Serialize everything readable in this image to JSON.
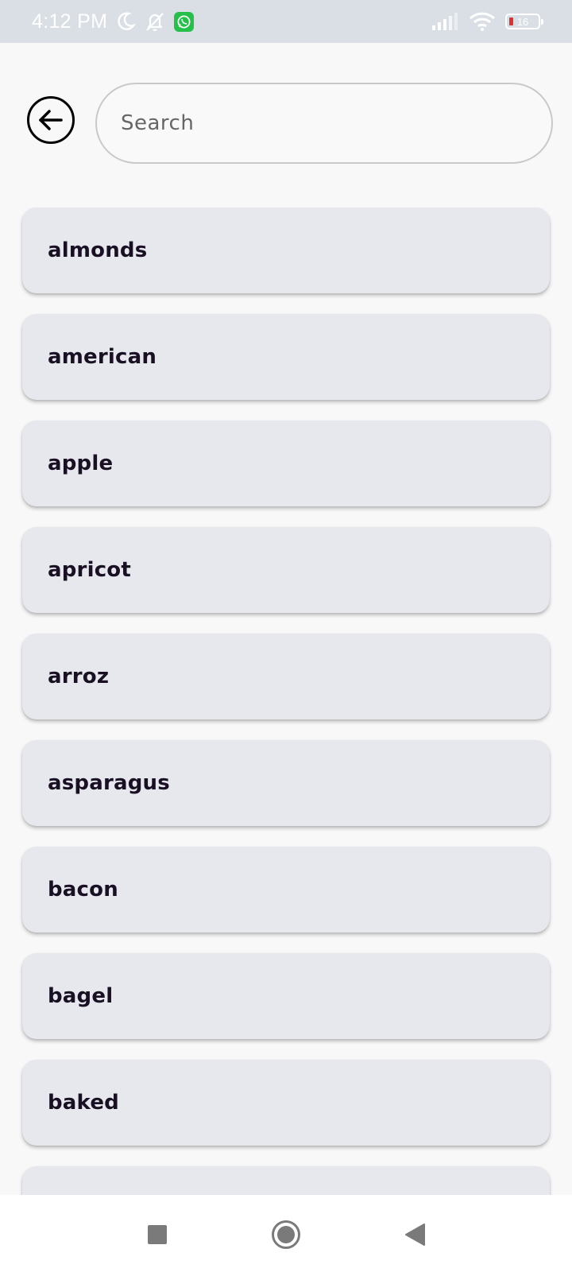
{
  "status_bar": {
    "time": "4:12 PM",
    "battery_level": "16",
    "icons": [
      "moon-icon",
      "bell-off-icon",
      "whatsapp-icon",
      "signal-icon",
      "wifi-icon",
      "battery-icon"
    ]
  },
  "search": {
    "placeholder": "Search",
    "value": ""
  },
  "items": [
    {
      "label": "almonds"
    },
    {
      "label": "american"
    },
    {
      "label": "apple"
    },
    {
      "label": "apricot"
    },
    {
      "label": "arroz"
    },
    {
      "label": "asparagus"
    },
    {
      "label": "bacon"
    },
    {
      "label": "bagel"
    },
    {
      "label": "baked"
    },
    {
      "label": ""
    }
  ],
  "nav_bar": {
    "icons": [
      "recents-square-icon",
      "home-circle-icon",
      "back-triangle-icon"
    ]
  },
  "colors": {
    "status_bar_bg": "#d9dfe5",
    "page_bg": "#f8f8f8",
    "item_bg": "#e6e8ed",
    "item_text": "#1a1024"
  }
}
